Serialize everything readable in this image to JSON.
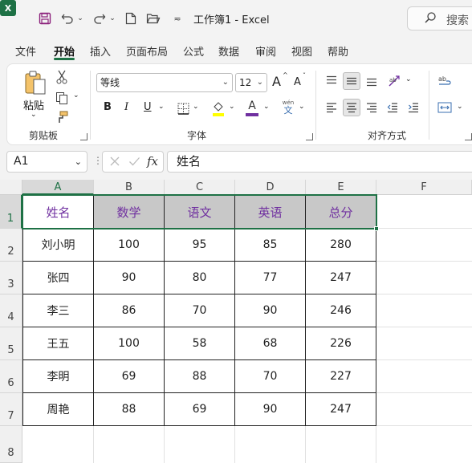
{
  "titlebar": {
    "app_logo": "X",
    "title": "工作簿1  -  Excel",
    "search_placeholder": "搜索",
    "icons": [
      "save-icon",
      "undo-icon",
      "redo-icon",
      "new-file-icon",
      "open-folder-icon",
      "customize-qat-icon",
      "search-icon"
    ]
  },
  "tabs": [
    "文件",
    "开始",
    "插入",
    "页面布局",
    "公式",
    "数据",
    "审阅",
    "视图",
    "帮助"
  ],
  "active_tab": "开始",
  "ribbon": {
    "clipboard": {
      "paste_label": "粘贴",
      "group_label": "剪贴板"
    },
    "font": {
      "font_name": "等线",
      "font_size": "12",
      "group_label": "字体",
      "bold": "B",
      "italic": "I",
      "underline": "U",
      "font_color_letter": "A",
      "phonetic_top": "wén",
      "phonetic_bottom": "文",
      "grow_font": "A",
      "shrink_font": "A"
    },
    "alignment": {
      "group_label": "对齐方式"
    },
    "accent_colors": {
      "highlight": "#ffff00",
      "font_color": "#7030a0"
    }
  },
  "formula_bar": {
    "name_box": "A1",
    "fx_label": "fx",
    "formula": "姓名"
  },
  "sheet": {
    "columns": [
      "A",
      "B",
      "C",
      "D",
      "E",
      "F"
    ],
    "rows": [
      "1",
      "2",
      "3",
      "4",
      "5",
      "6",
      "7",
      "8"
    ],
    "headers": [
      "姓名",
      "数学",
      "语文",
      "英语",
      "总分"
    ],
    "data": [
      [
        "刘小明",
        "100",
        "95",
        "85",
        "280"
      ],
      [
        "张四",
        "90",
        "80",
        "77",
        "247"
      ],
      [
        "李三",
        "86",
        "70",
        "90",
        "246"
      ],
      [
        "王五",
        "100",
        "58",
        "68",
        "226"
      ],
      [
        "李明",
        "69",
        "88",
        "70",
        "227"
      ],
      [
        "周艳",
        "88",
        "69",
        "90",
        "247"
      ]
    ],
    "header_text_color": "#7030a0",
    "header_fill": "#c8c8c8",
    "selection_color": "#1e7145"
  }
}
